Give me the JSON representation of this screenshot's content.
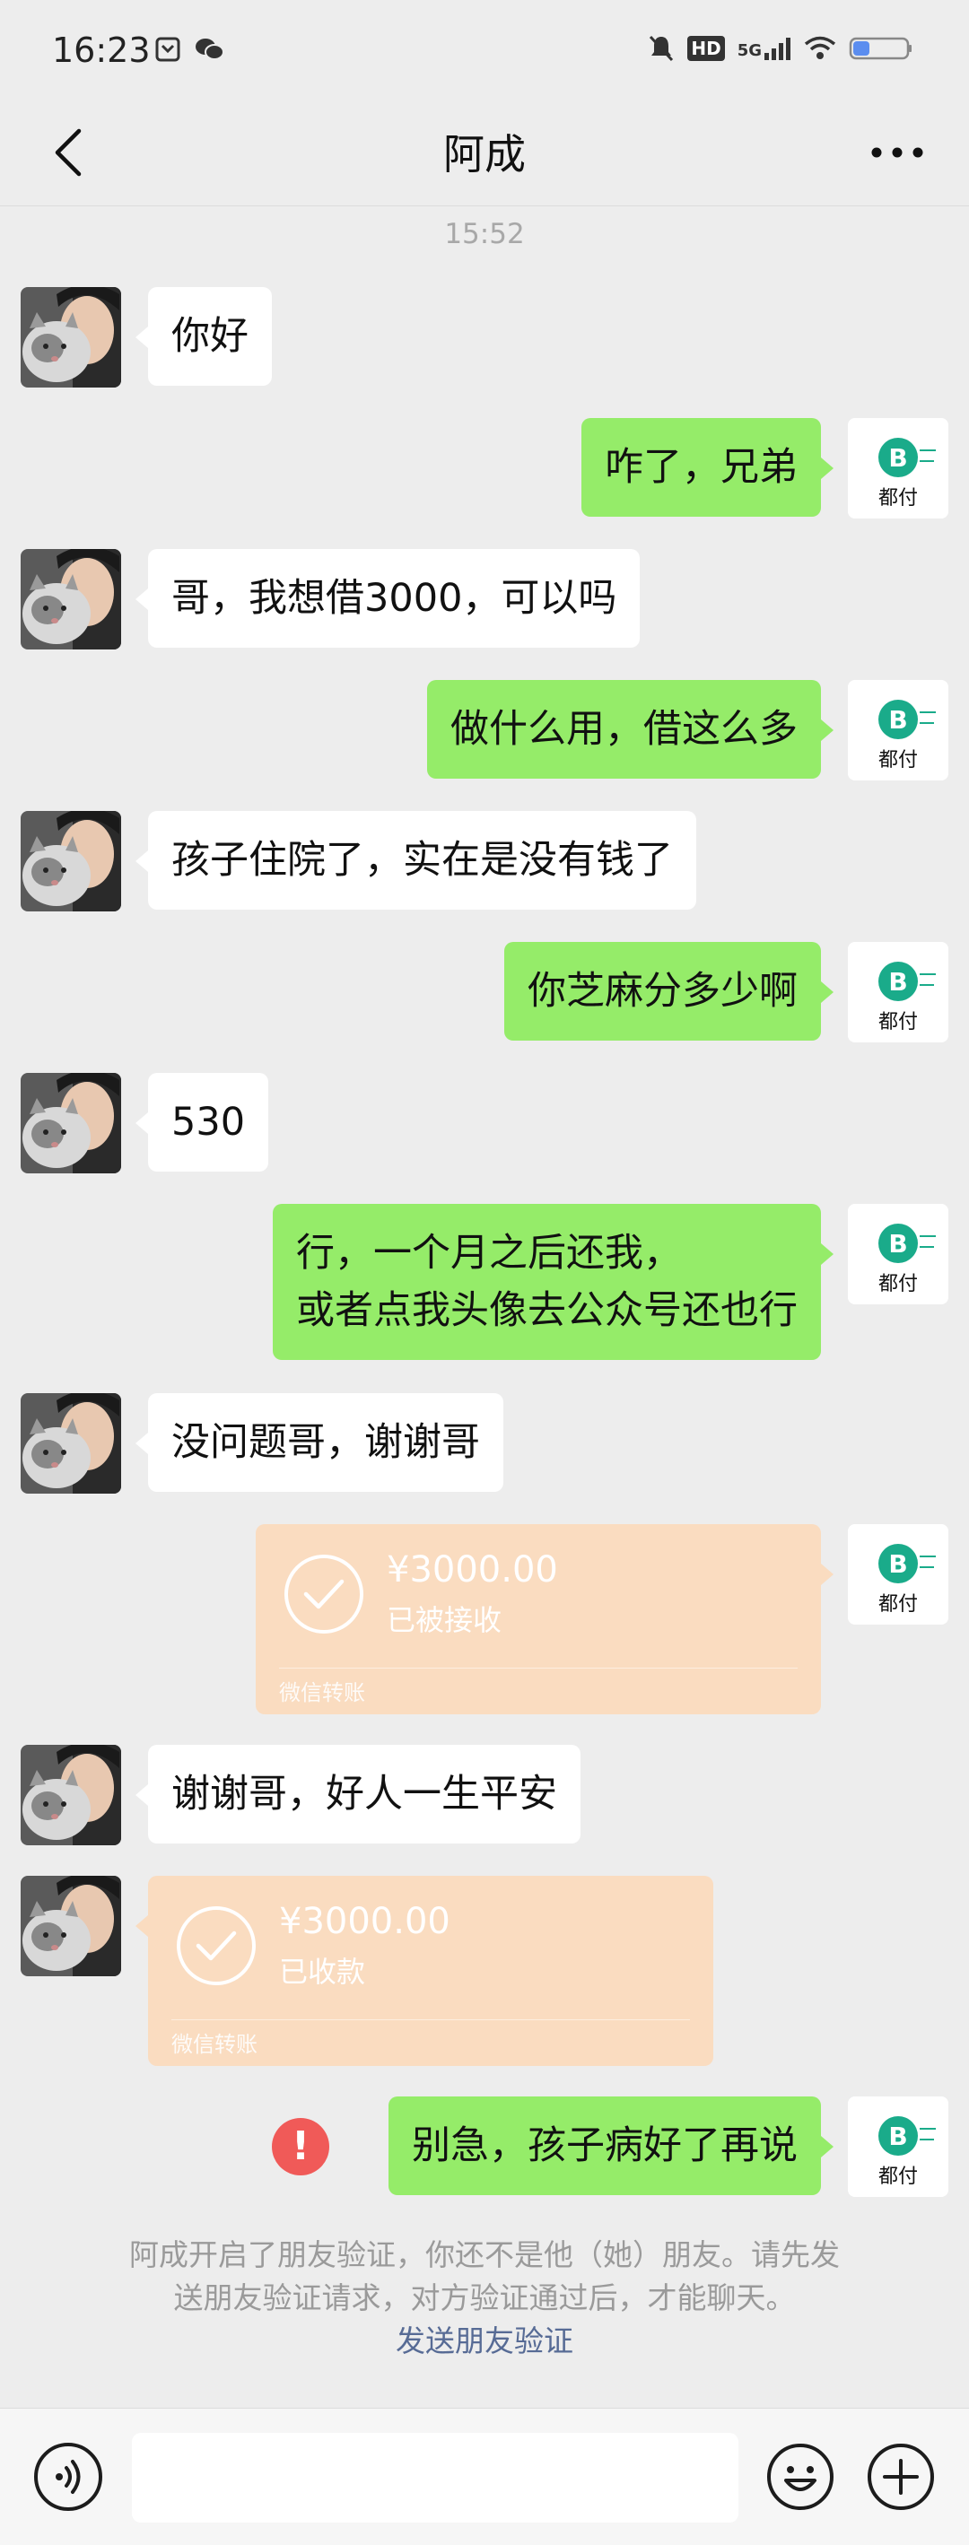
{
  "status_bar": {
    "time": "16:23",
    "icons": [
      "screenshot-icon",
      "wechat-icon",
      "mute-icon",
      "hd-icon",
      "signal-5g-icon",
      "wifi-icon",
      "battery-icon"
    ],
    "hd_label": "HD",
    "network_label": "5G"
  },
  "header": {
    "title": "阿成",
    "back_icon": "back-arrow-icon",
    "more_icon": "more-dots-icon"
  },
  "chat": {
    "timestamp": "15:52",
    "self_avatar_label": "都付",
    "messages": [
      {
        "from": "contact",
        "text": "你好"
      },
      {
        "from": "self",
        "text": "咋了，兄弟"
      },
      {
        "from": "contact",
        "text": "哥，我想借3000，可以吗"
      },
      {
        "from": "self",
        "text": "做什么用，借这么多"
      },
      {
        "from": "contact",
        "text": "孩子住院了，实在是没有钱了"
      },
      {
        "from": "self",
        "text": "你芝麻分多少啊"
      },
      {
        "from": "contact",
        "text": "530"
      },
      {
        "from": "self",
        "lines": [
          "行，一个月之后还我，",
          "或者点我头像去公众号还也行"
        ]
      },
      {
        "from": "contact",
        "text": "没问题哥，谢谢哥"
      },
      {
        "from": "self",
        "type": "transfer",
        "amount": "¥3000.00",
        "status": "已被接收",
        "label": "微信转账"
      },
      {
        "from": "contact",
        "text": "谢谢哥，好人一生平安"
      },
      {
        "from": "contact",
        "type": "transfer",
        "amount": "¥3000.00",
        "status": "已收款",
        "label": "微信转账"
      },
      {
        "from": "self",
        "text": "别急，孩子病好了再说",
        "send_failed": true,
        "fail_symbol": "!"
      }
    ]
  },
  "system_notice": {
    "line1": "阿成开启了朋友验证，你还不是他（她）朋友。请先发",
    "line2": "送朋友验证请求，对方验证通过后，才能聊天。",
    "link": "发送朋友验证"
  },
  "input_bar": {
    "voice_icon": "voice-icon",
    "emoji_icon": "emoji-icon",
    "plus_icon": "plus-icon",
    "placeholder": ""
  },
  "colors": {
    "background": "#ededed",
    "self_bubble": "#95ec69",
    "contact_bubble": "#ffffff",
    "transfer_card": "#fadcc0",
    "link": "#576b95",
    "error": "#f05a58"
  }
}
